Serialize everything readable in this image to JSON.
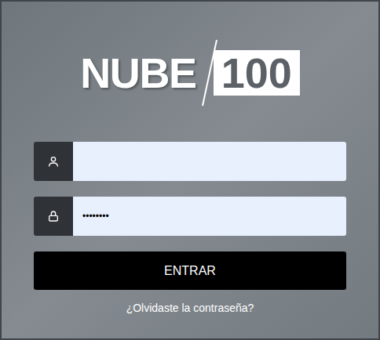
{
  "logo": {
    "text": "NUBE",
    "badge": "100"
  },
  "username": {
    "value": ""
  },
  "password": {
    "value": "••••••••"
  },
  "button": {
    "label": "ENTRAR"
  },
  "link": {
    "label": "¿Olvidaste la contraseña?"
  }
}
